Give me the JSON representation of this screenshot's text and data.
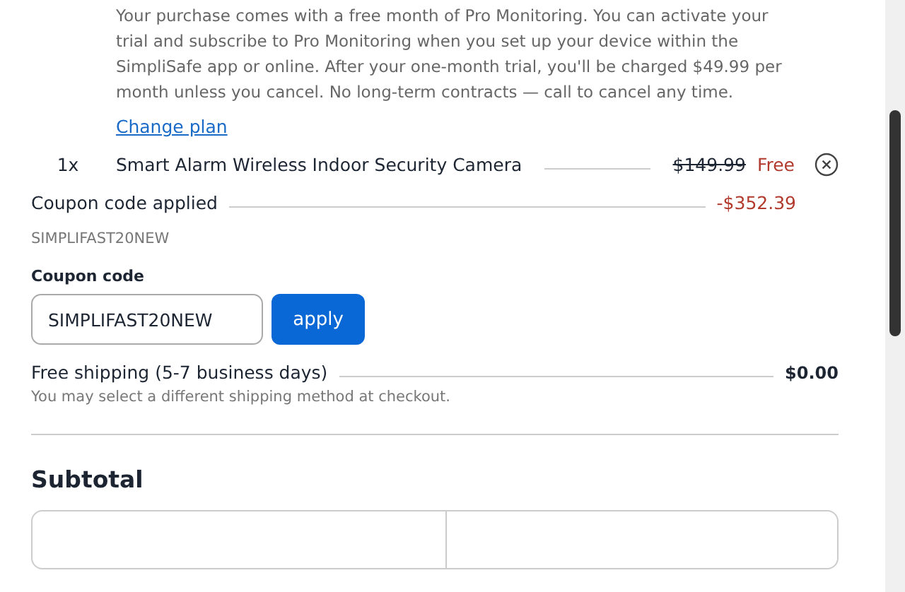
{
  "plan_note": "Your purchase comes with a free month of Pro Monitoring. You can activate your trial and subscribe to Pro Monitoring when you set up your device within the SimpliSafe app or online. After your one-month trial, you'll be charged $49.99 per month unless you cancel. No long-term contracts — call to cancel any time.",
  "change_plan_link": "Change plan",
  "line_items": [
    {
      "quantity": "1x",
      "name": "Smart Alarm Wireless Indoor Security Camera",
      "original_price": "$149.99",
      "price": "Free"
    }
  ],
  "coupon_applied": {
    "label": "Coupon code applied",
    "amount": "-$352.39",
    "code": "SIMPLIFAST20NEW"
  },
  "coupon_form": {
    "label": "Coupon code",
    "value": "SIMPLIFAST20NEW",
    "button": "apply"
  },
  "shipping": {
    "label": "Free shipping (5-7 business days)",
    "amount": "$0.00",
    "note": "You may select a different shipping method at checkout."
  },
  "subtotal_heading": "Subtotal"
}
